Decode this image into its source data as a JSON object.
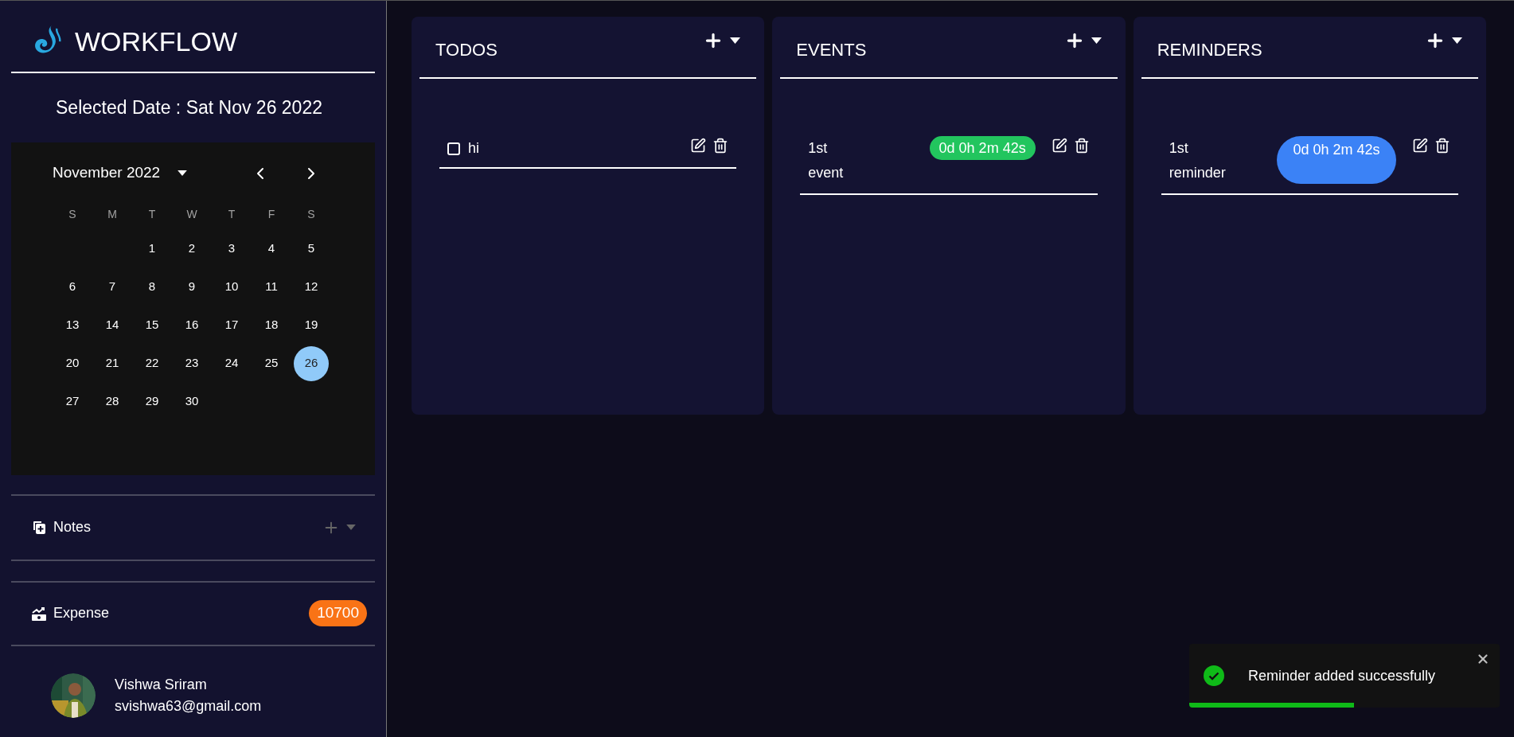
{
  "logo": {
    "text": "WORKFLOW"
  },
  "selected_date": "Selected Date : Sat Nov 26 2022",
  "calendar": {
    "month": "November 2022",
    "weekdays": [
      "S",
      "M",
      "T",
      "W",
      "T",
      "F",
      "S"
    ],
    "weeks": [
      {
        "kind": "short_start",
        "days": [
          {
            "label": "1",
            "selected": false
          },
          {
            "label": "2",
            "selected": false
          },
          {
            "label": "3",
            "selected": false
          },
          {
            "label": "4",
            "selected": false
          },
          {
            "label": "5",
            "selected": false
          }
        ]
      },
      {
        "kind": "full",
        "days": [
          {
            "label": "6",
            "selected": false
          },
          {
            "label": "7",
            "selected": false
          },
          {
            "label": "8",
            "selected": false
          },
          {
            "label": "9",
            "selected": false
          },
          {
            "label": "10",
            "selected": false
          },
          {
            "label": "11",
            "selected": false
          },
          {
            "label": "12",
            "selected": false
          }
        ]
      },
      {
        "kind": "full",
        "days": [
          {
            "label": "13",
            "selected": false
          },
          {
            "label": "14",
            "selected": false
          },
          {
            "label": "15",
            "selected": false
          },
          {
            "label": "16",
            "selected": false
          },
          {
            "label": "17",
            "selected": false
          },
          {
            "label": "18",
            "selected": false
          },
          {
            "label": "19",
            "selected": false
          }
        ]
      },
      {
        "kind": "full",
        "days": [
          {
            "label": "20",
            "selected": false
          },
          {
            "label": "21",
            "selected": false
          },
          {
            "label": "22",
            "selected": false
          },
          {
            "label": "23",
            "selected": false
          },
          {
            "label": "24",
            "selected": false
          },
          {
            "label": "25",
            "selected": false
          },
          {
            "label": "26",
            "selected": true
          }
        ]
      },
      {
        "kind": "short_end",
        "days": [
          {
            "label": "27",
            "selected": false
          },
          {
            "label": "28",
            "selected": false
          },
          {
            "label": "29",
            "selected": false
          },
          {
            "label": "30",
            "selected": false
          }
        ]
      }
    ]
  },
  "sidebar": {
    "sections": [
      {
        "kind": "notes",
        "label": "Notes"
      },
      {
        "kind": "expense",
        "label": "Expense",
        "badge": "10700"
      }
    ]
  },
  "user": {
    "name": "Vishwa Sriram",
    "email": "svishwa63@gmail.com"
  },
  "panels": [
    {
      "title": "TODOS",
      "items": [
        {
          "kind": "todo",
          "text": "hi",
          "checked": false
        }
      ]
    },
    {
      "title": "EVENTS",
      "items": [
        {
          "kind": "event",
          "text": "1st event",
          "countdown": "0d 0h 2m 42s",
          "color": "#22c55e"
        }
      ]
    },
    {
      "title": "REMINDERS",
      "items": [
        {
          "kind": "reminder",
          "text": "1st reminder",
          "countdown": "0d 0h 2m 42s",
          "color": "#3b82f6"
        }
      ]
    }
  ],
  "toast": {
    "message": "Reminder added successfully",
    "level": 0.53
  }
}
